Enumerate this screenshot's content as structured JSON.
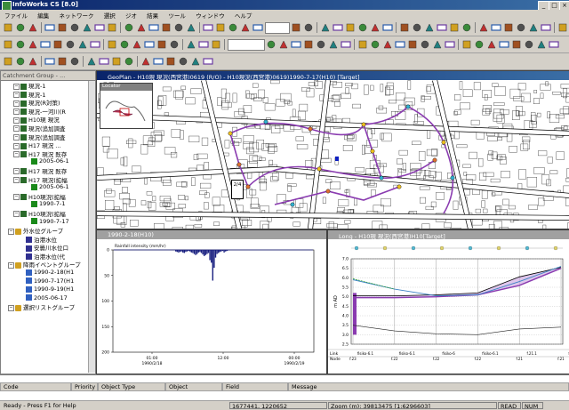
{
  "window": {
    "title": "InfoWorks CS [8.0]",
    "buttons": [
      "_",
      "□",
      "×"
    ]
  },
  "menu": {
    "items": [
      "ファイル",
      "編集",
      "ネットワーク",
      "選択",
      "ジオ",
      "結果",
      "ツール",
      "ウィンドウ",
      "ヘルプ"
    ]
  },
  "tree": {
    "title": "Catchment Group - ...",
    "items": [
      {
        "label": "現況-1",
        "icon": "network",
        "indent": 2
      },
      {
        "label": "現況-1",
        "icon": "network",
        "indent": 2
      },
      {
        "label": "現況(R対策)",
        "icon": "network",
        "indent": 2
      },
      {
        "label": "現況-一河川(R",
        "icon": "network",
        "indent": 2
      },
      {
        "label": "H10現 現況",
        "icon": "network",
        "indent": 2
      },
      {
        "label": "現況(追加調査",
        "icon": "network",
        "indent": 2
      },
      {
        "label": "現況(追加調査",
        "icon": "network",
        "indent": 2
      },
      {
        "label": "H17 現況 ...",
        "icon": "network",
        "indent": 2
      },
      {
        "label": "H17 現況 既存",
        "icon": "network",
        "indent": 2
      },
      {
        "label": "2005-06-1",
        "icon": "run",
        "indent": 4
      },
      {
        "label": "H17 現況 既存",
        "icon": "network",
        "indent": 2
      },
      {
        "label": "H17 現況(拡幅",
        "icon": "network",
        "indent": 2
      },
      {
        "label": "2005-06-1",
        "icon": "run",
        "indent": 4
      },
      {
        "label": "H10現況(拡幅",
        "icon": "network",
        "indent": 2
      },
      {
        "label": "1990-7-1",
        "icon": "run",
        "indent": 4
      },
      {
        "label": "H10現況(拡幅",
        "icon": "network",
        "indent": 2
      },
      {
        "label": "1990-7-17",
        "icon": "run",
        "indent": 4
      },
      {
        "label": "外水位グループ",
        "icon": "folder",
        "indent": 1
      },
      {
        "label": "泊港水位",
        "icon": "level",
        "indent": 3
      },
      {
        "label": "安曇川水位口",
        "icon": "level",
        "indent": 3
      },
      {
        "label": "泊港水位(代",
        "icon": "level",
        "indent": 3
      },
      {
        "label": "降雨イベントグループ",
        "icon": "folder",
        "indent": 1
      },
      {
        "label": "1990-2-18(H1",
        "icon": "rain",
        "indent": 3
      },
      {
        "label": "1990-7-17(H1",
        "icon": "rain",
        "indent": 3
      },
      {
        "label": "1990-9-19(H1",
        "icon": "rain",
        "indent": 3
      },
      {
        "label": "2005-06-17",
        "icon": "rain",
        "indent": 3
      },
      {
        "label": "選択リストグループ",
        "icon": "folder",
        "indent": 1
      }
    ]
  },
  "geoplan": {
    "title": "GeoPlan - H10現 現況(西宮港)0619 (R/O) - H10現況(西宮港)0619)1990-7-17(H10) [Target]",
    "locator": "Locator",
    "callout": "2/4"
  },
  "graph": {
    "title": "1990-2-18(H10)",
    "label": "Rainfall intensity (mm/hr)",
    "x_ticks": [
      "01:00\n1990/2/18",
      "12:00",
      "00:00\n1990/2/19"
    ],
    "y_ticks": [
      "0",
      "50",
      "100",
      "150",
      "200"
    ]
  },
  "long_section": {
    "title": "Long - H10現 現況(西宮港)H10[Target]",
    "ylabel": "m AD",
    "y_ticks": [
      "7.0",
      "6.5",
      "6.0",
      "5.5",
      "5.0",
      "4.5",
      "4.0",
      "3.5",
      "3.0",
      "2.5"
    ],
    "rows": {
      "link_label": "Link",
      "node_label": "Node"
    },
    "links": [
      "fisiko-6.1",
      "fisiko-6.1",
      "fisiko-6",
      "fisiko-6.1",
      "f.21.1",
      "f.21.1"
    ],
    "nodes": [
      "f.23",
      "f.22",
      "f.22",
      "f.22",
      "f.21",
      "f.21"
    ]
  },
  "messages": {
    "columns": [
      "Code",
      "Priority",
      "Object Type",
      "Object",
      "Field",
      "Message"
    ]
  },
  "status": {
    "help": "Ready - Press F1 for Help",
    "coords": "1677441, 1220652",
    "zoom": "Zoom (m): 39813475 [1:6296603]",
    "mode": "READ",
    "num": "NUM"
  },
  "colors": {
    "titlebar": "#0a246a",
    "rain": "#1a2080",
    "section_pipe": "#8a3bb0",
    "ground_line": "#3b82c4"
  },
  "chart_data": [
    {
      "type": "bar",
      "title": "1990-2-18(H10)",
      "ylabel": "Rainfall intensity (mm/hr)",
      "ylim": [
        0,
        200
      ],
      "y_inverted": true,
      "bins": 66,
      "values": [
        3,
        4,
        5,
        4,
        3,
        5,
        6,
        4,
        3,
        2,
        3,
        5,
        6,
        8,
        10,
        8,
        5,
        4,
        6,
        9,
        12,
        10,
        8,
        6,
        20,
        25,
        60,
        35,
        15,
        8,
        6,
        4,
        3,
        2,
        5,
        3,
        2,
        1,
        0,
        0,
        0,
        0,
        0,
        0,
        0,
        0,
        0,
        0,
        0,
        0,
        0,
        0,
        0,
        0,
        0,
        0,
        0,
        0,
        0,
        0,
        0,
        0,
        0,
        0,
        0,
        0
      ]
    },
    {
      "type": "line",
      "title": "Long - H10現 現況(西宮港)H10[Target]",
      "ylabel": "m AD",
      "ylim": [
        2.5,
        7.0
      ],
      "x": [
        0,
        1,
        2,
        3,
        4,
        5
      ],
      "series": [
        {
          "values": [
            5.05,
            5.05,
            5.1,
            5.2,
            6.05,
            6.55
          ]
        },
        {
          "values": [
            4.95,
            4.95,
            5.0,
            5.1,
            5.6,
            6.5
          ]
        },
        {
          "values": [
            3.5,
            3.2,
            3.05,
            3.0,
            3.3,
            3.4
          ]
        }
      ]
    }
  ]
}
